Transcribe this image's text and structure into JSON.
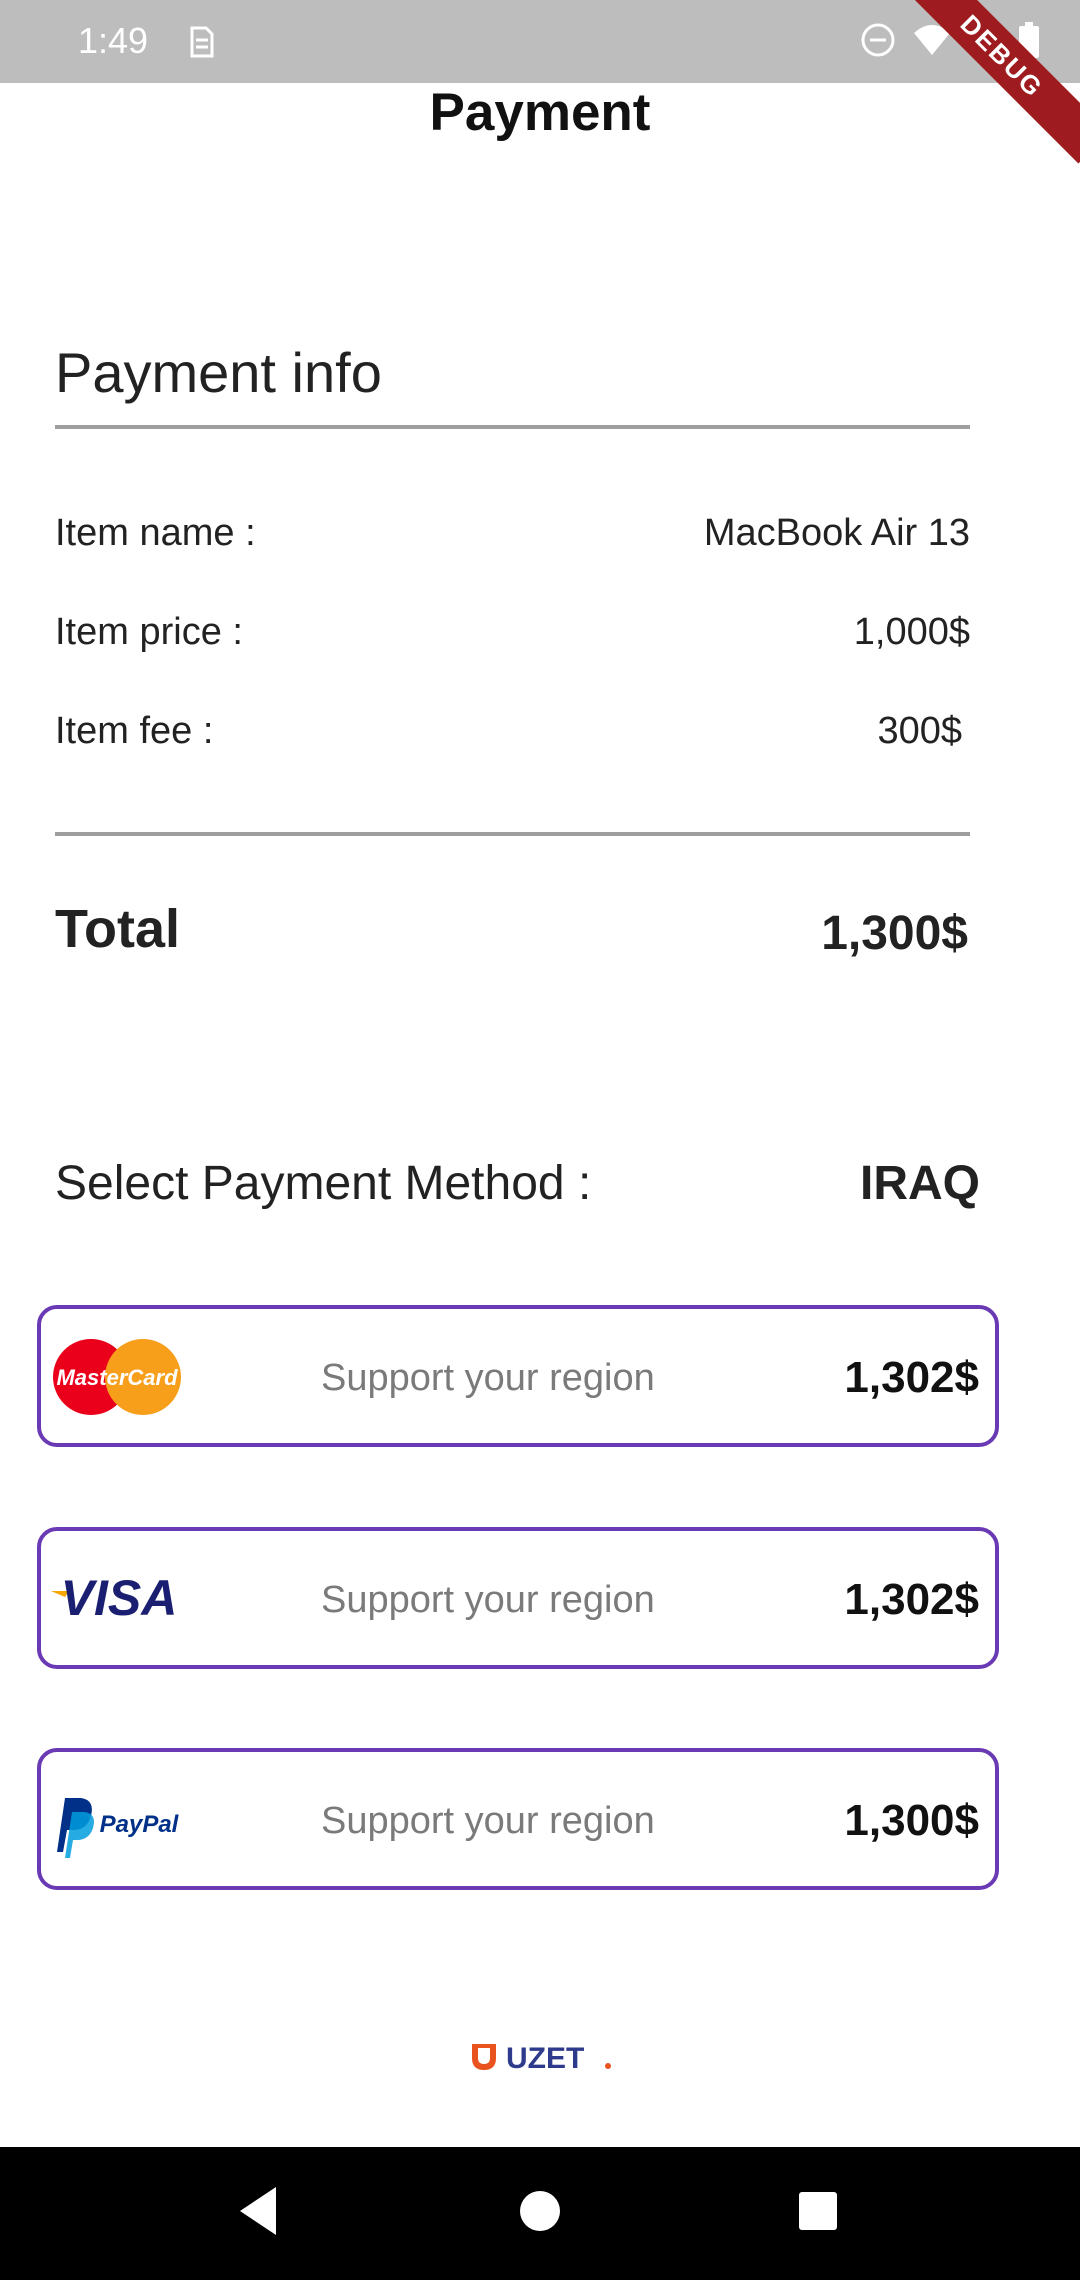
{
  "status_bar": {
    "time": "1:49",
    "debug_label": "DEBUG"
  },
  "header": {
    "title": "Payment"
  },
  "payment_info": {
    "heading": "Payment info",
    "rows": [
      {
        "label": "Item name :",
        "value": "MacBook Air 13"
      },
      {
        "label": "Item price :",
        "value": "1,000$"
      },
      {
        "label": "Item fee :",
        "value": "300$"
      }
    ],
    "total_label": "Total",
    "total_value": "1,300$"
  },
  "payment_method": {
    "label": "Select Payment Method :",
    "region": "IRAQ",
    "options": [
      {
        "logo": "mastercard-logo",
        "logo_text": "MasterCard",
        "description": "Support your region",
        "amount": "1,302$"
      },
      {
        "logo": "visa-logo",
        "logo_text": "VISA",
        "description": "Support your region",
        "amount": "1,302$"
      },
      {
        "logo": "paypal-logo",
        "logo_text": "PayPal",
        "description": "Support your region",
        "amount": "1,300$"
      }
    ]
  },
  "footer": {
    "brand": "UZET"
  },
  "colors": {
    "card_border": "#6a3ab5",
    "status_bar": "#bdbdbd",
    "divider": "#9e9e9e",
    "brand_orange": "#e8531f",
    "brand_blue": "#2e3a8c"
  }
}
